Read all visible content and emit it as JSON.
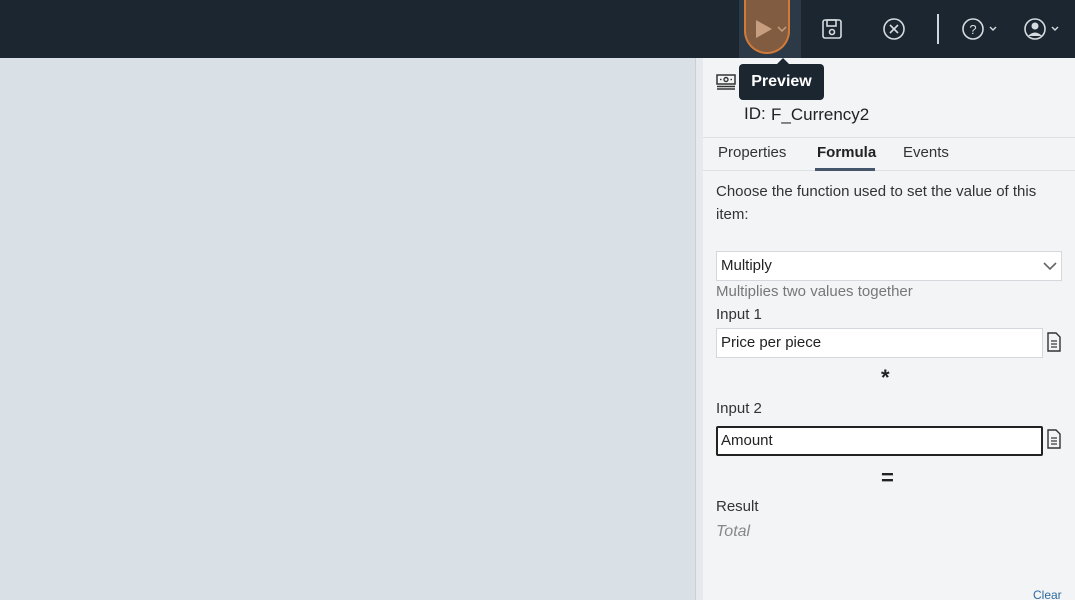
{
  "toolbar": {
    "run_icon": "play-icon",
    "save_icon": "save-icon",
    "close_icon": "close-circle-icon",
    "help_icon": "help-circle-icon",
    "user_icon": "user-account-icon",
    "tooltip": "Preview"
  },
  "panel": {
    "item_icon": "currency-icon",
    "id_label": "ID:",
    "id_value": "F_Currency2",
    "tabs": {
      "properties": "Properties",
      "formula": "Formula",
      "events": "Events",
      "active": "Formula"
    },
    "description": "Choose the function used to set the value of this item:",
    "function_select": {
      "value": "Multiply"
    },
    "function_help": "Multiplies two values together",
    "input1": {
      "label": "Input 1",
      "value": "Price per piece"
    },
    "operator": "*",
    "input2": {
      "label": "Input 2",
      "value": "Amount"
    },
    "equals": "=",
    "result": {
      "label": "Result",
      "value": "Total"
    },
    "clear_link": "Clear"
  },
  "colors": {
    "topbar": "#1c2631",
    "canvas": "#d9e0e6",
    "panel": "#f3f4f5",
    "accent_link": "#2d6aa0",
    "highlight": "#d07a3a"
  }
}
